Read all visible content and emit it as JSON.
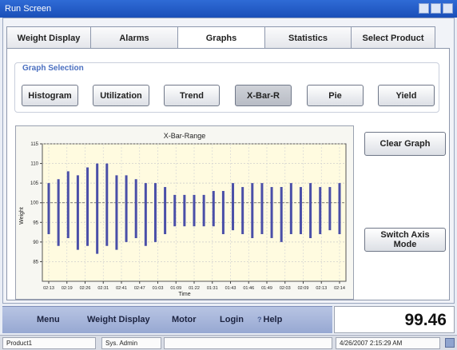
{
  "window": {
    "title": "Run Screen"
  },
  "tabs": [
    {
      "label": "Weight Display",
      "active": false
    },
    {
      "label": "Alarms",
      "active": false
    },
    {
      "label": "Graphs",
      "active": true
    },
    {
      "label": "Statistics",
      "active": false
    },
    {
      "label": "Select Product",
      "active": false
    }
  ],
  "graph_selection": {
    "title": "Graph Selection",
    "buttons": [
      "Histogram",
      "Utilization",
      "Trend",
      "X-Bar-R",
      "Pie",
      "Yield"
    ],
    "selected": "X-Bar-R"
  },
  "side_buttons": {
    "clear_graph": "Clear Graph",
    "switch_axis": "Switch Axis\nMode"
  },
  "chart_data": {
    "type": "range",
    "title": "X-Bar-Range",
    "xlabel": "Time",
    "ylabel": "Weight",
    "ylim": [
      80,
      115
    ],
    "yticks": [
      "115",
      "110",
      "105",
      "100",
      "95",
      "90",
      "85"
    ],
    "xticks": [
      "02:13",
      "02:19",
      "02:26",
      "02:31",
      "02:41",
      "02:47",
      "01:03",
      "01:09",
      "01:22",
      "01:31",
      "01:43",
      "01:46",
      "01:49",
      "02:03",
      "02:09",
      "02:13",
      "02:14"
    ],
    "mean_line": 100,
    "grid": true,
    "series": [
      {
        "values": [
          [
            92,
            105
          ],
          [
            89,
            106
          ],
          [
            91,
            108
          ],
          [
            88,
            107
          ],
          [
            89,
            109
          ],
          [
            87,
            110
          ],
          [
            89,
            110
          ],
          [
            88,
            107
          ],
          [
            90,
            107
          ],
          [
            91,
            106
          ],
          [
            89,
            105
          ],
          [
            90,
            105
          ],
          [
            92,
            104
          ],
          [
            94,
            102
          ],
          [
            94,
            102
          ],
          [
            94,
            102
          ],
          [
            94,
            102
          ],
          [
            94,
            103
          ],
          [
            92,
            103
          ],
          [
            93,
            105
          ],
          [
            92,
            104
          ],
          [
            91,
            105
          ],
          [
            92,
            105
          ],
          [
            91,
            104
          ],
          [
            90,
            104
          ],
          [
            92,
            105
          ],
          [
            92,
            104
          ],
          [
            91,
            105
          ],
          [
            92,
            104
          ],
          [
            93,
            104
          ],
          [
            92,
            105
          ]
        ]
      }
    ]
  },
  "menu": {
    "items": [
      "Menu",
      "Weight Display",
      "Motor",
      "Login"
    ],
    "help": "Help",
    "help_icon": "question-icon",
    "value": "99.46"
  },
  "status": {
    "product": "Product1",
    "user": "Sys. Admin",
    "datetime": "4/26/2007 2:15:29 AM"
  },
  "colors": {
    "bar": "#4a4fa8",
    "plot_bg": "#fffbe0",
    "accent": "#4a6fc0"
  }
}
